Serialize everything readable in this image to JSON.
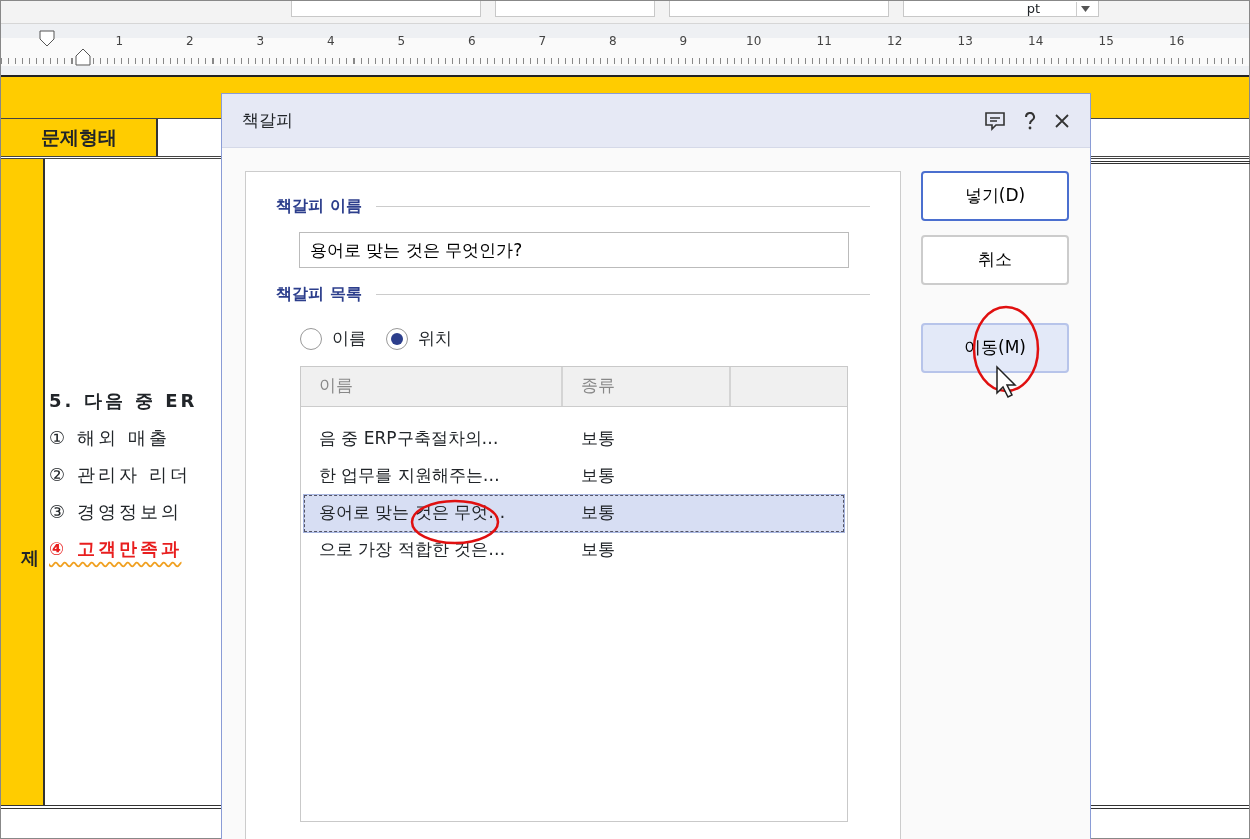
{
  "toolbar": {
    "unit": "pt"
  },
  "ruler": {
    "marks": [
      "1",
      "2",
      "3",
      "4",
      "5",
      "6",
      "7",
      "8",
      "9",
      "10",
      "11",
      "12",
      "13",
      "14",
      "15",
      "16"
    ]
  },
  "document": {
    "type_label": "문제형태",
    "side_label": "제",
    "lines": [
      {
        "text": "5. 다음 중 ER",
        "kind": "question",
        "answer": false
      },
      {
        "text": "① 해외 매출",
        "kind": "option",
        "answer": false
      },
      {
        "text": "② 관리자 리더",
        "kind": "option",
        "answer": false
      },
      {
        "text": "③ 경영정보의",
        "kind": "option",
        "answer": false
      },
      {
        "text": "④ 고객만족과",
        "kind": "option",
        "answer": true
      }
    ]
  },
  "dialog": {
    "title": "책갈피",
    "name_section": "책갈피 이름",
    "name_value": "용어로 맞는 것은 무엇인가?",
    "list_section": "책갈피 목록",
    "sort_options": [
      {
        "label": "이름",
        "selected": false
      },
      {
        "label": "위치",
        "selected": true
      }
    ],
    "columns": [
      "이름",
      "종류"
    ],
    "rows": [
      {
        "name": "음 중 ERP구축절차의…",
        "type": "보통",
        "selected": false
      },
      {
        "name": "한 업무를 지원해주는…",
        "type": "보통",
        "selected": false
      },
      {
        "name": "용어로 맞는 것은 무엇…",
        "type": "보통",
        "selected": true
      },
      {
        "name": "으로 가장 적합한 것은…",
        "type": "보통",
        "selected": false
      }
    ],
    "buttons": [
      {
        "label": "넣기(D)",
        "default": true,
        "hovered": false
      },
      {
        "label": "취소",
        "default": false,
        "hovered": false
      },
      {
        "label": "이동(M)",
        "default": false,
        "hovered": true
      }
    ]
  }
}
